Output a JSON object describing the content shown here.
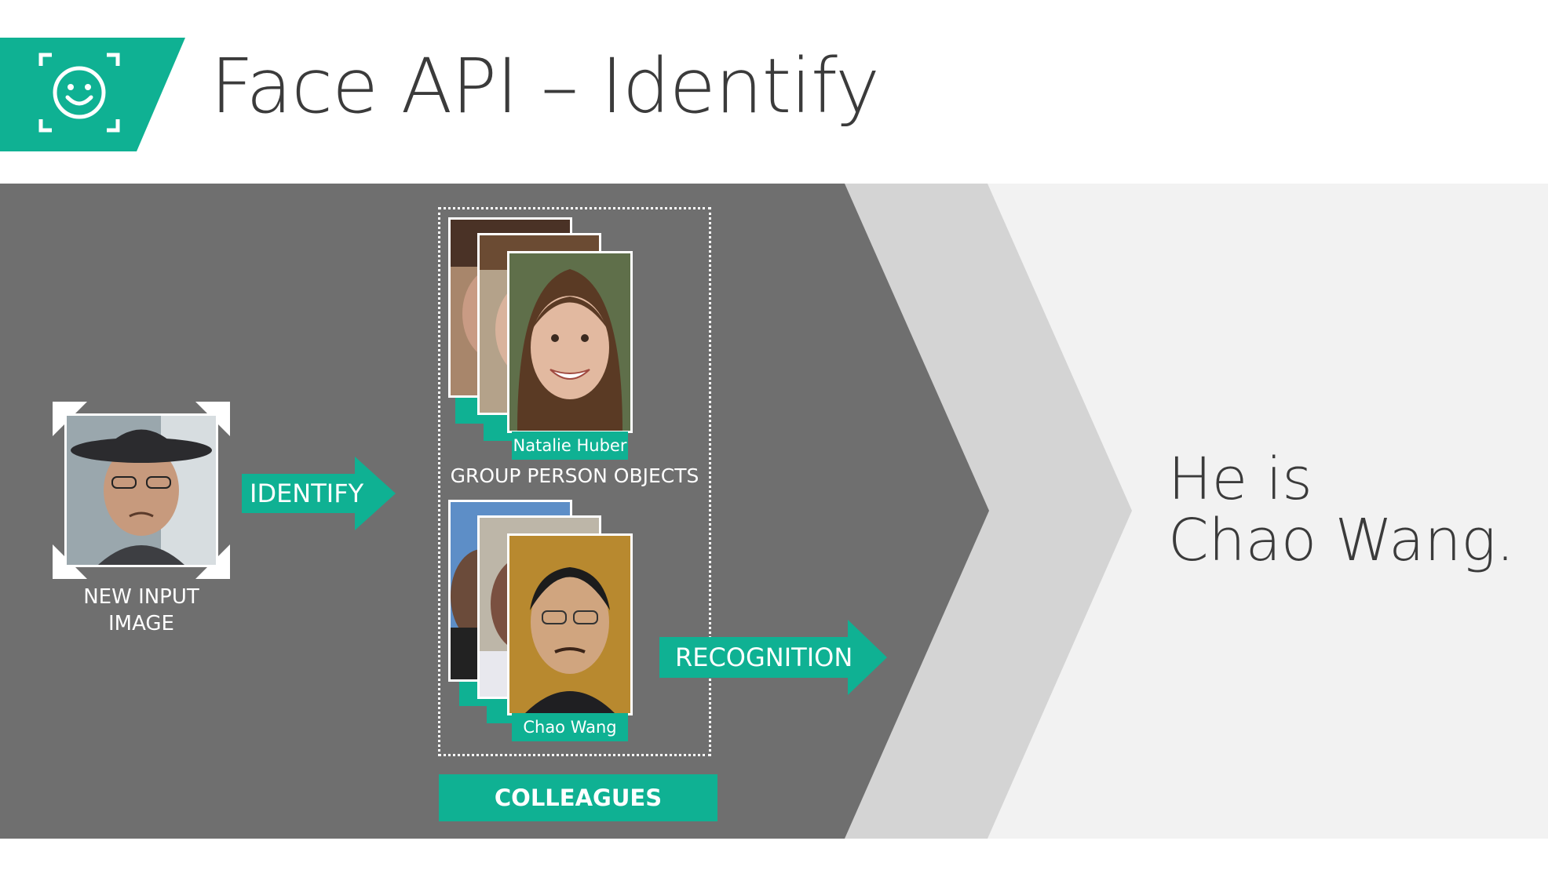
{
  "slide": {
    "title": "Face API – Identify",
    "logo_icon": "smiley-face-scan-icon"
  },
  "flow": {
    "input_label_line1": "NEW INPUT",
    "input_label_line2": "IMAGE",
    "identify_arrow_label": "IDENTIFY",
    "group_label": "GROUP PERSON OBJECTS",
    "person_top_name": "Natalie Huber",
    "person_bottom_name": "Chao Wang",
    "recognition_arrow_label": "RECOGNITION",
    "group_name_button": "COLLEAGUES"
  },
  "result": {
    "line1": "He is",
    "line2": "Chao Wang."
  },
  "colors": {
    "accent": "#0fb193",
    "panel_dark": "#6f6f6f",
    "chevron_light": "#d4d4d4",
    "result_bg": "#f2f2f2",
    "title_text": "#3b3b3b"
  }
}
